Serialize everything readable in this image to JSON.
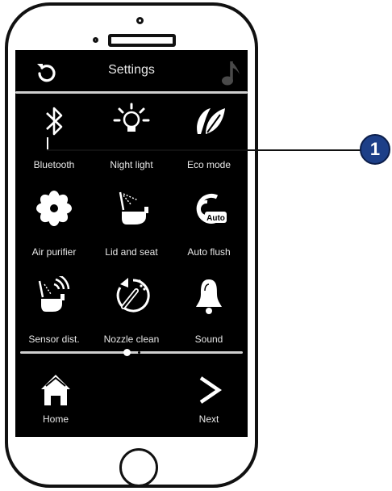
{
  "header": {
    "title": "Settings",
    "back_icon": "refresh-back-icon",
    "music_icon": "music-note-icon"
  },
  "tiles": [
    {
      "label": "Bluetooth",
      "icon": "bluetooth-icon"
    },
    {
      "label": "Night light",
      "icon": "lightbulb-icon"
    },
    {
      "label": "Eco mode",
      "icon": "leaf-icon"
    },
    {
      "label": "Air purifier",
      "icon": "flower-icon"
    },
    {
      "label": "Lid and seat",
      "icon": "toilet-lid-icon"
    },
    {
      "label": "Auto flush",
      "icon": "auto-flush-icon"
    },
    {
      "label": "Sensor dist.",
      "icon": "sensor-icon"
    },
    {
      "label": "Nozzle clean",
      "icon": "nozzle-icon"
    },
    {
      "label": "Sound",
      "icon": "bell-icon"
    }
  ],
  "auto_badge": "Auto",
  "page_indicator": {
    "pages": 2,
    "current": 1
  },
  "nav": {
    "home_label": "Home",
    "next_label": "Next"
  },
  "callout": {
    "number": "1"
  },
  "colors": {
    "screen": "#000000",
    "callout": "#1d3f88"
  }
}
